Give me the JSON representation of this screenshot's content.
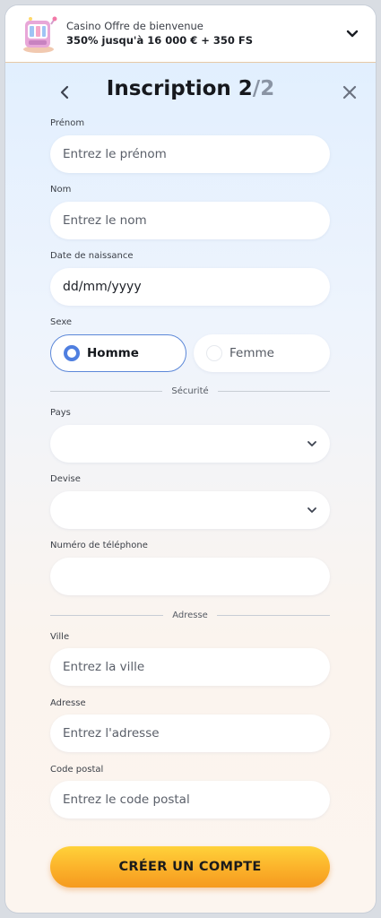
{
  "promo": {
    "title": "Casino Offre de bienvenue",
    "subtitle": "350% jusqu'à 16 000 € + 350 FS"
  },
  "header": {
    "title_text": "Inscription",
    "step_current": "2",
    "step_separator": "/",
    "step_total": "2"
  },
  "form": {
    "first_name": {
      "label": "Prénom",
      "placeholder": "Entrez le prénom"
    },
    "last_name": {
      "label": "Nom",
      "placeholder": "Entrez le nom"
    },
    "birth_date": {
      "label": "Date de naissance",
      "value": "dd/mm/yyyy"
    },
    "gender": {
      "label": "Sexe",
      "options": [
        "Homme",
        "Femme"
      ],
      "selected": "Homme"
    },
    "security_section": "Sécurité",
    "country": {
      "label": "Pays",
      "value": ""
    },
    "currency": {
      "label": "Devise",
      "value": ""
    },
    "phone": {
      "label": "Numéro de téléphone",
      "value": ""
    },
    "address_section": "Adresse",
    "city": {
      "label": "Ville",
      "placeholder": "Entrez la ville"
    },
    "address": {
      "label": "Adresse",
      "placeholder": "Entrez l'adresse"
    },
    "postal_code": {
      "label": "Code postal",
      "placeholder": "Entrez le code postal"
    }
  },
  "submit_label": "CRÉER UN COMPTE",
  "icons": {
    "promo": "slot-machine-icon",
    "expand": "chevron-down-icon",
    "back": "chevron-left-icon",
    "close": "close-icon",
    "dropdown": "chevron-down-icon"
  },
  "colors": {
    "accent": "#4f7fe0",
    "cta_top": "#ffd23a",
    "cta_bottom": "#f59a1e",
    "promo_border": "#e7c9a6"
  }
}
